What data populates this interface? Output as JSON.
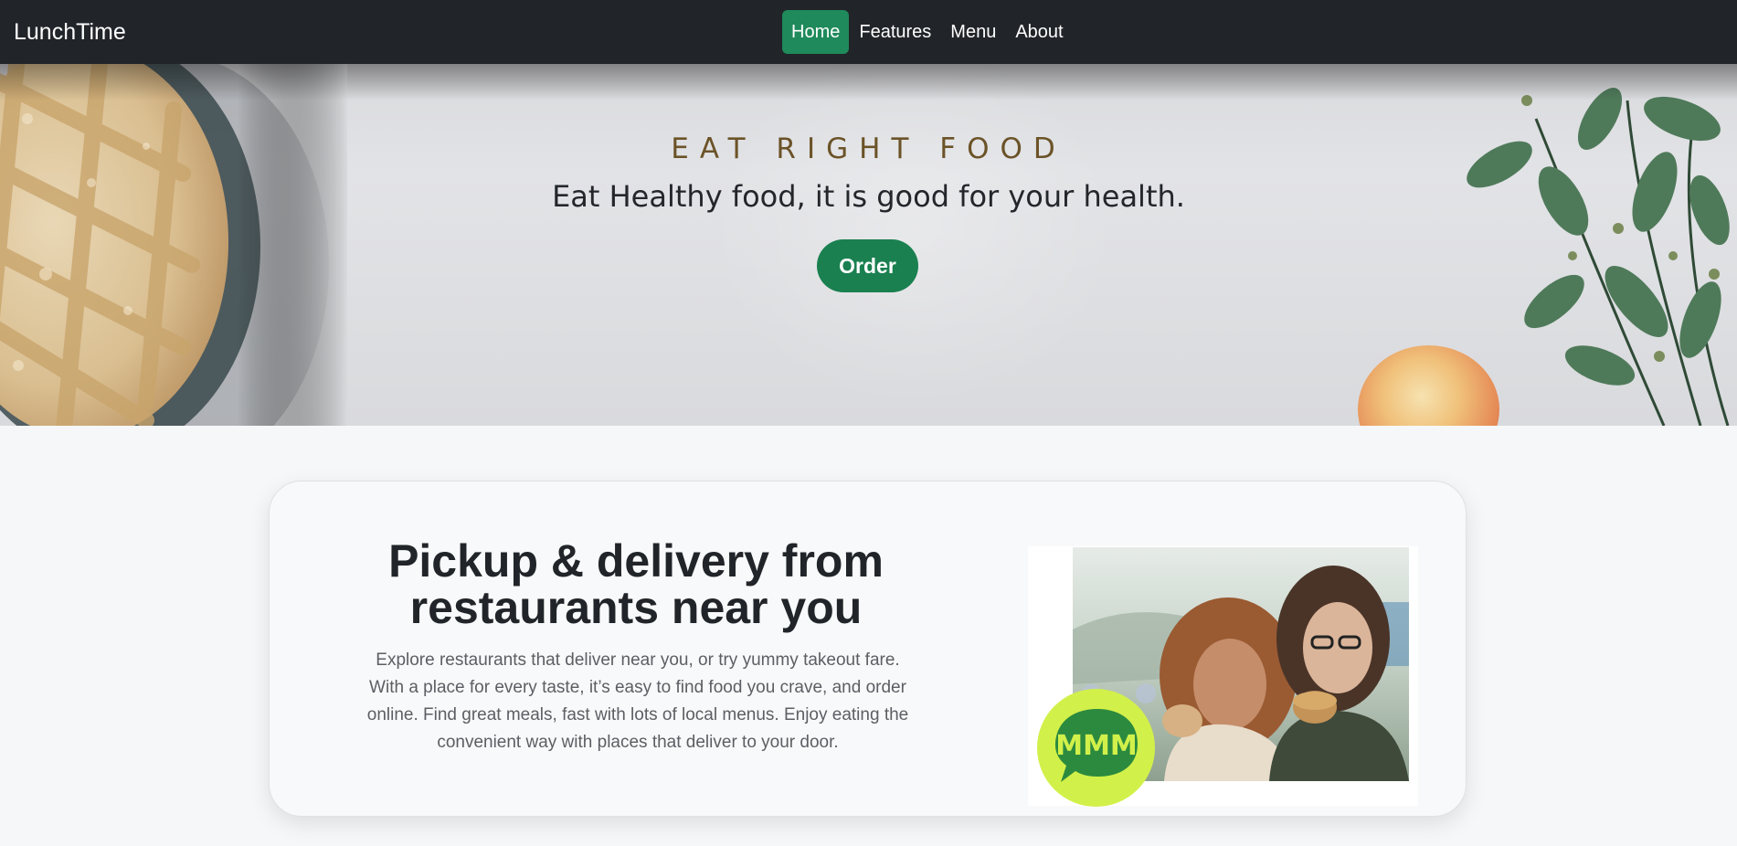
{
  "navbar": {
    "brand": "LunchTime",
    "links": [
      {
        "label": "Home",
        "active": true
      },
      {
        "label": "Features",
        "active": false
      },
      {
        "label": "Menu",
        "active": false
      },
      {
        "label": "About",
        "active": false
      }
    ]
  },
  "hero": {
    "eyebrow": "EAT RIGHT FOOD",
    "tagline": "Eat Healthy food, it is good for your health.",
    "order_label": "Order"
  },
  "feature": {
    "title": "Pickup & delivery from restaurants near you",
    "text": "Explore restaurants that deliver near you, or try yummy takeout fare. With a place for every taste, it’s easy to find food you crave, and order online. Find great meals, fast with lots of local menus. Enjoy eating the convenient way with places that deliver to your door.",
    "badge_text": "MMM"
  },
  "colors": {
    "navbar_bg": "#212429",
    "accent_green": "#1a8050",
    "nav_active": "#1f8a5b",
    "eyebrow": "#6b5328",
    "badge": "#d2f04a"
  }
}
